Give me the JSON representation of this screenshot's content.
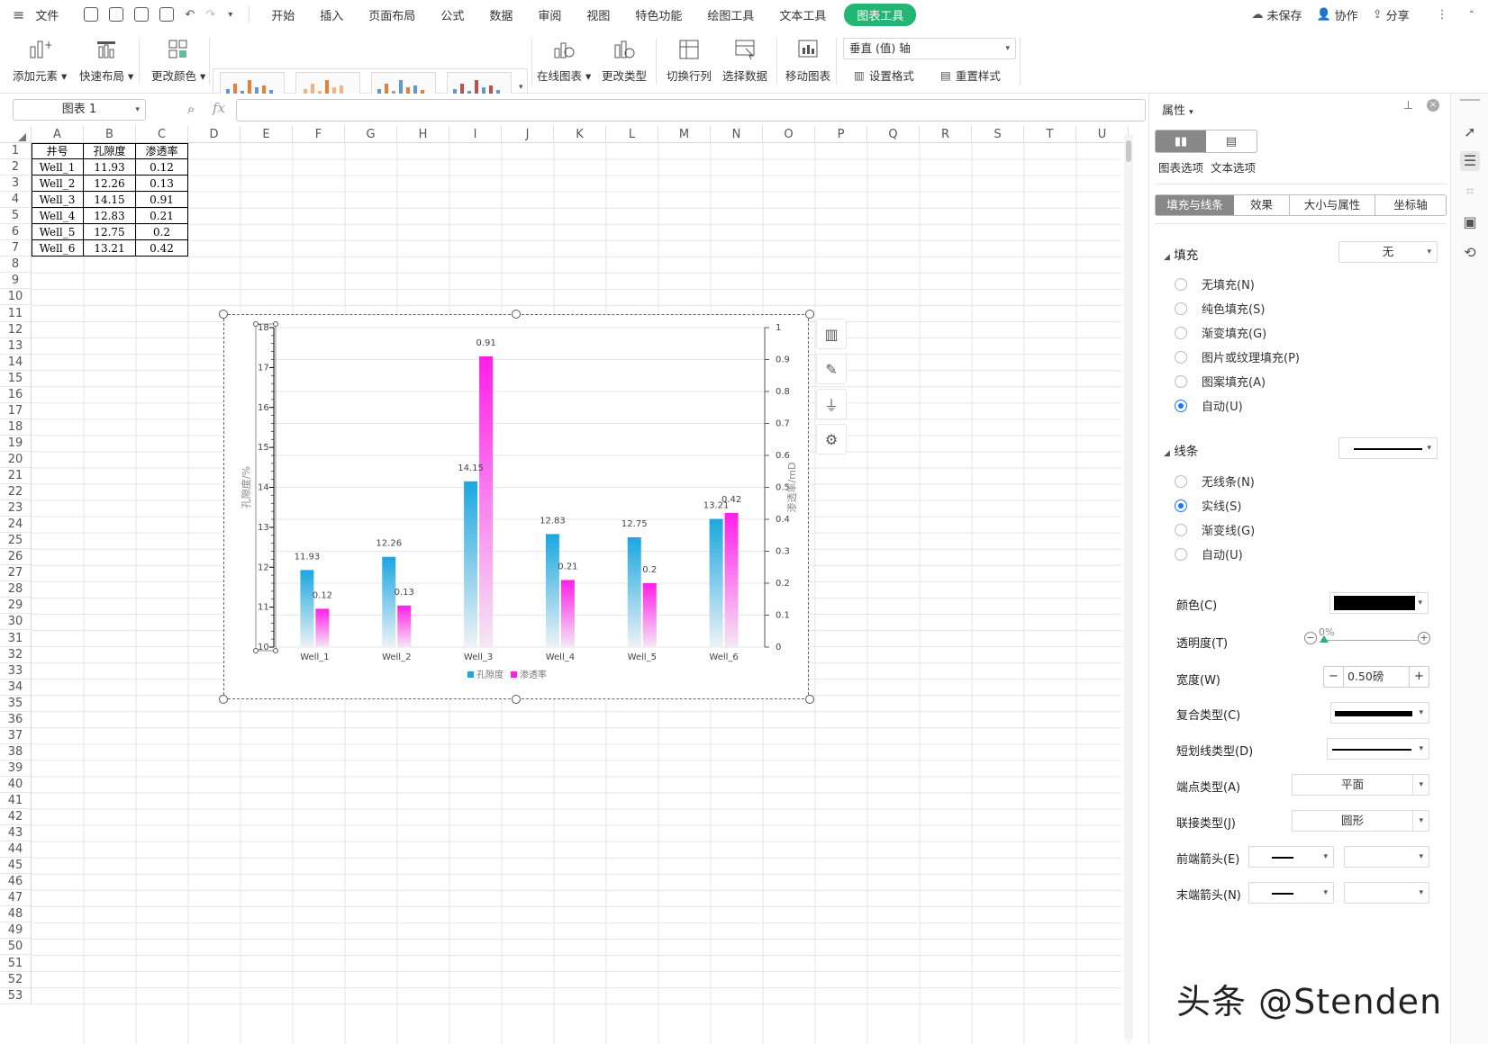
{
  "topbar": {
    "menu_label": "文件",
    "tabs": [
      "开始",
      "插入",
      "页面布局",
      "公式",
      "数据",
      "审阅",
      "视图",
      "特色功能",
      "绘图工具",
      "文本工具",
      "图表工具"
    ],
    "active_tab": "图表工具",
    "unsaved": "未保存",
    "collab": "协作",
    "share": "分享"
  },
  "ribbon": {
    "add_element": "添加元素",
    "quick_layout": "快速布局",
    "change_color": "更改颜色",
    "online_chart": "在线图表",
    "change_type": "更改类型",
    "switch_rowcol": "切换行列",
    "select_data": "选择数据",
    "move_chart": "移动图表",
    "axis_select": "垂直 (值) 轴",
    "set_format": "设置格式",
    "reset_style": "重置样式"
  },
  "formula": {
    "name_box": "图表 1",
    "fx": "fx",
    "value": ""
  },
  "sheet": {
    "columns": [
      "A",
      "B",
      "C",
      "D",
      "E",
      "F",
      "G",
      "H",
      "I",
      "J",
      "K",
      "L",
      "M",
      "N",
      "O",
      "P",
      "Q",
      "R",
      "S",
      "T",
      "U"
    ],
    "rows": [
      "1",
      "2",
      "3",
      "4",
      "5",
      "6",
      "7",
      "8",
      "9",
      "10",
      "11",
      "12",
      "13",
      "14",
      "15",
      "16",
      "17",
      "18",
      "19",
      "20",
      "21",
      "22",
      "23",
      "24",
      "25",
      "26",
      "27",
      "28",
      "29",
      "30",
      "31",
      "32",
      "33",
      "34",
      "35",
      "36",
      "37",
      "38",
      "39",
      "40",
      "41",
      "42",
      "43",
      "44",
      "45",
      "46",
      "47",
      "48",
      "49",
      "50",
      "51",
      "52",
      "53"
    ],
    "table": [
      [
        "井号",
        "孔隙度",
        "渗透率"
      ],
      [
        "Well_1",
        "11.93",
        "0.12"
      ],
      [
        "Well_2",
        "12.26",
        "0.13"
      ],
      [
        "Well_3",
        "14.15",
        "0.91"
      ],
      [
        "Well_4",
        "12.83",
        "0.21"
      ],
      [
        "Well_5",
        "12.75",
        "0.2"
      ],
      [
        "Well_6",
        "13.21",
        "0.42"
      ]
    ]
  },
  "chart_data": {
    "type": "bar",
    "categories": [
      "Well_1",
      "Well_2",
      "Well_3",
      "Well_4",
      "Well_5",
      "Well_6"
    ],
    "series": [
      {
        "name": "孔隙度",
        "values": [
          11.93,
          12.26,
          14.15,
          12.83,
          12.75,
          13.21
        ],
        "axis": "left",
        "color": "#1aa7e0"
      },
      {
        "name": "渗透率",
        "values": [
          0.12,
          0.13,
          0.91,
          0.21,
          0.2,
          0.42
        ],
        "axis": "right",
        "color": "#ff1ee8"
      }
    ],
    "ylabel": "孔隙度/%",
    "y2label": "渗透率/mD",
    "ylim": [
      10,
      18
    ],
    "y2lim": [
      0,
      1
    ],
    "yticks": [
      "10",
      "11",
      "12",
      "13",
      "14",
      "15",
      "16",
      "17",
      "18"
    ],
    "y2ticks": [
      "0",
      "0.1",
      "0.2",
      "0.3",
      "0.4",
      "0.5",
      "0.6",
      "0.7",
      "0.8",
      "0.9",
      "1"
    ],
    "legend": "bottom",
    "grid": true
  },
  "panel": {
    "title": "属性",
    "tab_chart": "图表选项",
    "tab_text": "文本选项",
    "subtabs": [
      "填充与线条",
      "效果",
      "大小与属性",
      "坐标轴"
    ],
    "fill_section": "填充",
    "fill_value": "无",
    "fill_options": [
      "无填充(N)",
      "纯色填充(S)",
      "渐变填充(G)",
      "图片或纹理填充(P)",
      "图案填充(A)",
      "自动(U)"
    ],
    "line_section": "线条",
    "line_options": [
      "无线条(N)",
      "实线(S)",
      "渐变线(G)",
      "自动(U)"
    ],
    "color_label": "颜色(C)",
    "transparency_label": "透明度(T)",
    "transparency_value": "0%",
    "width_label": "宽度(W)",
    "width_value": "0.50磅",
    "compound_label": "复合类型(C)",
    "dash_label": "短划线类型(D)",
    "cap_label": "端点类型(A)",
    "cap_value": "平面",
    "join_label": "联接类型(J)",
    "join_value": "圆形",
    "begin_arrow_label": "前端箭头(E)",
    "end_arrow_label": "末端箭头(N)"
  },
  "watermark": "头条 @Stenden"
}
